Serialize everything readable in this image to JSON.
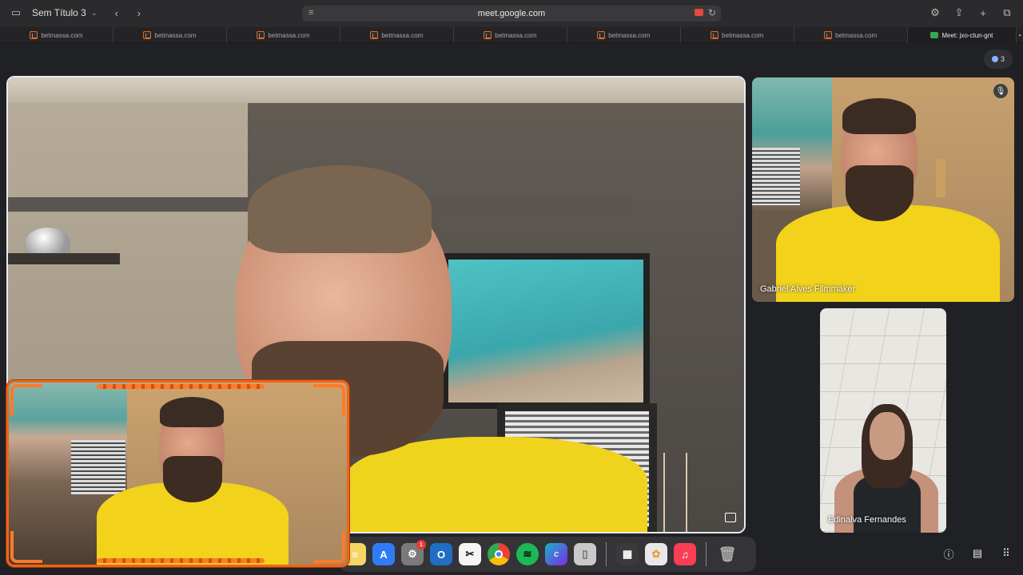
{
  "browser": {
    "tab_group_title": "Sem Título 3",
    "url": "meet.google.com",
    "tabs": [
      {
        "label": "betmassa.com"
      },
      {
        "label": "betmassa.com"
      },
      {
        "label": "betmassa.com"
      },
      {
        "label": "betmassa.com"
      },
      {
        "label": "betmassa.com"
      },
      {
        "label": "betmassa.com"
      },
      {
        "label": "betmassa.com"
      },
      {
        "label": "betmassa.com"
      },
      {
        "label": "Meet: jxo-ctun-gnt",
        "active": true
      }
    ]
  },
  "meet": {
    "participant_count": "3",
    "participants": [
      {
        "name": "Gabriel Alves Filmmaker",
        "muted": true
      },
      {
        "name": "Edinalva Fernandes"
      }
    ]
  },
  "dock": {
    "apps": [
      {
        "icon": "notes-icon",
        "color": "#f5d565"
      },
      {
        "icon": "app-store-icon",
        "color": "#2f7cf6"
      },
      {
        "icon": "system-settings-icon",
        "color": "#7a7a7a",
        "badge": "1"
      },
      {
        "icon": "outlook-icon",
        "color": "#1f6ec4"
      },
      {
        "icon": "capcut-icon",
        "color": "#111111"
      },
      {
        "icon": "chrome-icon",
        "color": "#4285f4"
      },
      {
        "icon": "spotify-icon",
        "color": "#1db954"
      },
      {
        "icon": "canva-icon",
        "color": "#17b3c5"
      },
      {
        "icon": "preview-icon",
        "color": "#c9c9c9"
      },
      {
        "icon": "calculator-icon",
        "color": "#3a3a3a"
      },
      {
        "icon": "photos-icon",
        "color": "#e8e8e8"
      },
      {
        "icon": "music-icon",
        "color": "#fa3e55"
      },
      {
        "icon": "trash-icon",
        "color": "#8a8a8a"
      }
    ]
  },
  "colors": {
    "pip_frame": "#f06418",
    "shirt": "#f2d21b",
    "meet_bg": "#202124"
  }
}
